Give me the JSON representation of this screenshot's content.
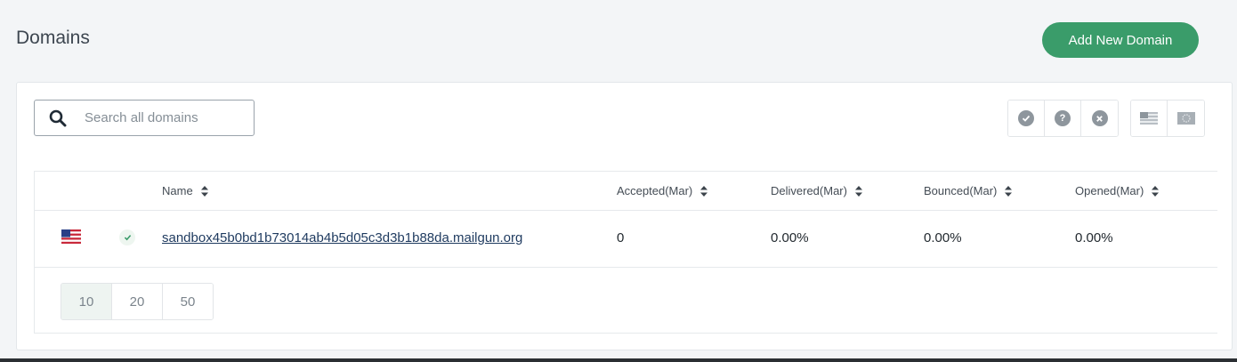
{
  "header": {
    "title": "Domains",
    "add_button_label": "Add New Domain"
  },
  "search": {
    "placeholder": "Search all domains",
    "value": ""
  },
  "filters": {
    "status": [
      {
        "name": "active-filter",
        "icon": "check-circle-icon"
      },
      {
        "name": "unverified-filter",
        "icon": "question-circle-icon"
      },
      {
        "name": "disabled-filter",
        "icon": "x-circle-icon"
      }
    ],
    "region": [
      {
        "name": "us-region-filter",
        "icon": "us-flag-icon"
      },
      {
        "name": "eu-region-filter",
        "icon": "eu-flag-icon"
      }
    ]
  },
  "table": {
    "columns": {
      "name": "Name",
      "accepted": "Accepted(Mar)",
      "delivered": "Delivered(Mar)",
      "bounced": "Bounced(Mar)",
      "opened": "Opened(Mar)"
    },
    "rows": [
      {
        "region_icon": "us-flag-icon",
        "status_icon": "check-icon",
        "name": "sandbox45b0bd1b73014ab4b5d05c3d3b1b88da.mailgun.org",
        "accepted": "0",
        "delivered": "0.00%",
        "bounced": "0.00%",
        "opened": "0.00%"
      }
    ]
  },
  "pagination": {
    "sizes": [
      "10",
      "20",
      "50"
    ],
    "selected": "10"
  },
  "colors": {
    "accent": "#3a9c6a",
    "link": "#1e3a5f",
    "background": "#f3f5f7"
  }
}
